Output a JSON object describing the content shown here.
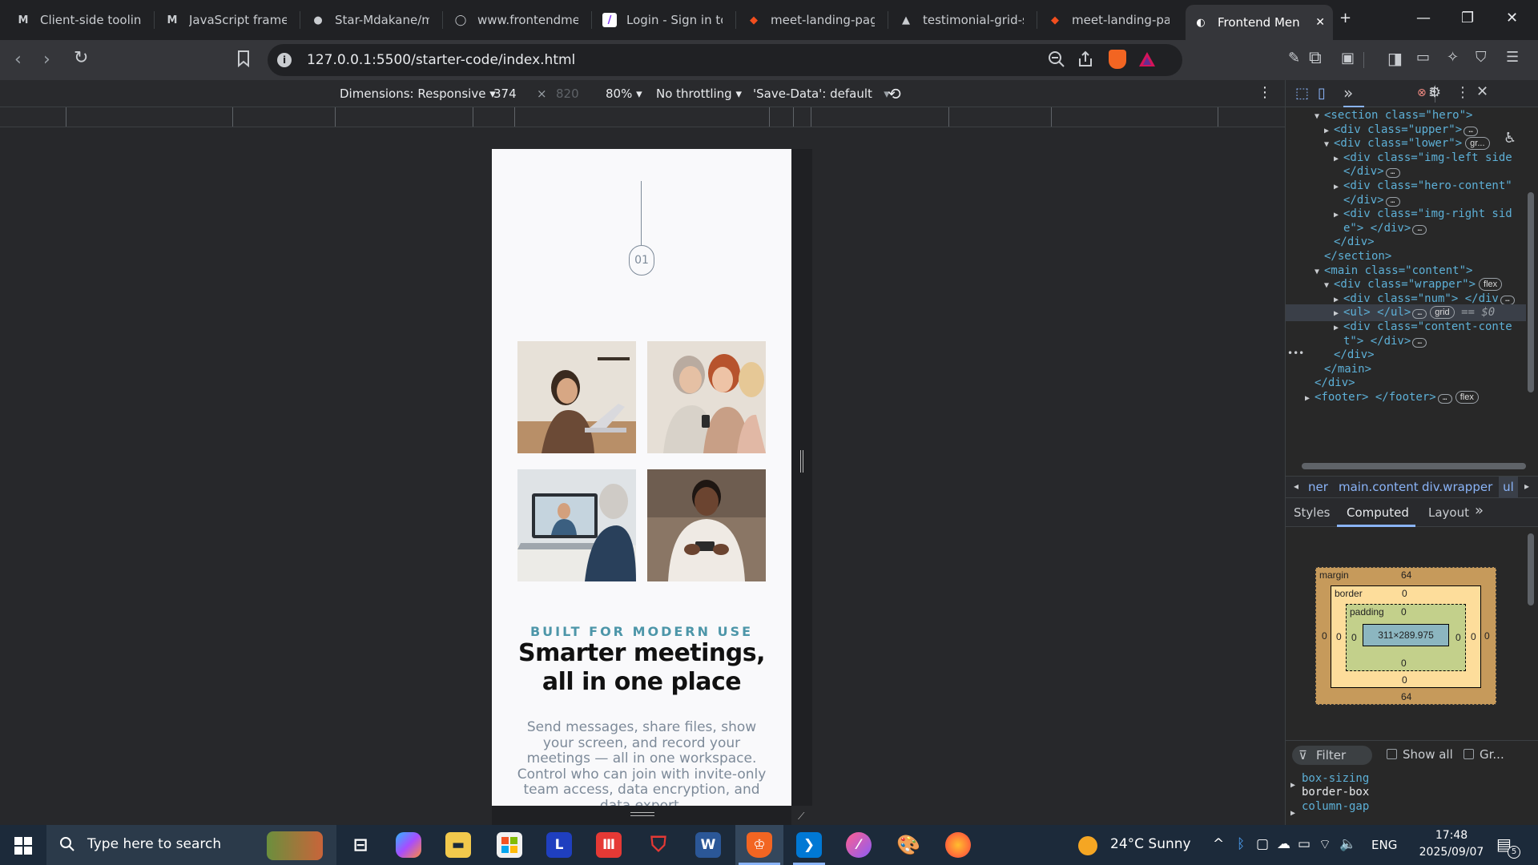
{
  "tabs": [
    {
      "title": "Client-side tooling",
      "icon": "M"
    },
    {
      "title": "JavaScript framew",
      "icon": "M"
    },
    {
      "title": "Star-Mdakane/me",
      "icon": "github"
    },
    {
      "title": "www.frontendmen",
      "icon": "circle"
    },
    {
      "title": "Login - Sign in to",
      "icon": "slash"
    },
    {
      "title": "meet-landing-pag",
      "icon": "figma"
    },
    {
      "title": "testimonial-grid-s",
      "icon": "triangle"
    },
    {
      "title": "meet-landing-pag",
      "icon": "figma"
    },
    {
      "title": "Frontend Men",
      "icon": "fm",
      "active": true
    }
  ],
  "address": {
    "url": "127.0.0.1:5500/starter-code/index.html",
    "badge_count": "3"
  },
  "devtools": {
    "dimensions_label": "Dimensions: Responsive",
    "width": "374",
    "times": "×",
    "height": "820",
    "zoom": "80%",
    "throttle": "No throttling",
    "save_data": "'Save-Data': default",
    "error_count": "3",
    "breadcrumbs": [
      "ner",
      "main.content",
      "div.wrapper",
      "ul"
    ],
    "pane_tabs": [
      "Styles",
      "Computed",
      "Layout"
    ],
    "box_model": {
      "margin_label": "margin",
      "margin": "64",
      "border_label": "border",
      "border": "0",
      "padding_label": "padding",
      "padding": "0",
      "content": "311×289.975",
      "zero": "0"
    },
    "filter_placeholder": "Filter",
    "show_all": "Show all",
    "group": "Gr...",
    "props": [
      {
        "name": "box-sizing",
        "value": "border-box"
      },
      {
        "name": "column-gap",
        "value": ""
      }
    ]
  },
  "code_lines": [
    {
      "indent": 4,
      "arrow": "open",
      "text": "<section class=\"hero\">"
    },
    {
      "indent": 5,
      "arrow": "closed",
      "text": "<div class=\"upper\">",
      "ell": true
    },
    {
      "indent": 5,
      "arrow": "open",
      "text": "<div class=\"lower\">",
      "badge": "gr..."
    },
    {
      "indent": 6,
      "arrow": "closed",
      "text": "<div class=\"img-left side"
    },
    {
      "indent": 6,
      "arrow": "",
      "text": "</div>",
      "ell": true
    },
    {
      "indent": 6,
      "arrow": "closed",
      "text": "<div class=\"hero-content\""
    },
    {
      "indent": 6,
      "arrow": "",
      "text": "</div>",
      "ell": true
    },
    {
      "indent": 6,
      "arrow": "closed",
      "text": "<div class=\"img-right sid"
    },
    {
      "indent": 6,
      "arrow": "",
      "text": "e\"> </div>",
      "ell": true
    },
    {
      "indent": 5,
      "arrow": "",
      "text": "</div>"
    },
    {
      "indent": 4,
      "arrow": "",
      "text": "</section>"
    },
    {
      "indent": 4,
      "arrow": "open",
      "text": "<main class=\"content\">"
    },
    {
      "indent": 5,
      "arrow": "open",
      "text": "<div class=\"wrapper\">",
      "badge": "flex"
    },
    {
      "indent": 6,
      "arrow": "closed",
      "text": "<div class=\"num\"> </div",
      "ell": true
    },
    {
      "indent": 6,
      "arrow": "closed",
      "text": "<ul> </ul>",
      "ell": true,
      "badge": "grid",
      "selected": true,
      "suffix": " == $0"
    },
    {
      "indent": 6,
      "arrow": "closed",
      "text": "<div class=\"content-conte"
    },
    {
      "indent": 6,
      "arrow": "",
      "text": "t\"> </div>",
      "ell": true
    },
    {
      "indent": 5,
      "arrow": "",
      "text": "</div>"
    },
    {
      "indent": 4,
      "arrow": "",
      "text": "</main>"
    },
    {
      "indent": 3,
      "arrow": "",
      "text": "</div>"
    },
    {
      "indent": 3,
      "arrow": "closed",
      "text": "<footer> </footer>",
      "ell": true,
      "badge": "flex"
    }
  ],
  "page": {
    "hero_number": "01",
    "eyebrow": "BUILT FOR MODERN USE",
    "heading": "Smarter meetings, all in one place",
    "paragraph": "Send messages, share files, show your screen, and record your meetings — all in one workspace. Control who can join with invite-only team access, data encryption, and data export.",
    "photos": [
      "woman-laptop",
      "women-phone",
      "man-video-call",
      "man-phone"
    ]
  },
  "taskbar": {
    "search_placeholder": "Type here to search",
    "weather": "24°C  Sunny",
    "lang": "ENG",
    "time": "17:48",
    "date": "2025/09/07",
    "notifications": "5"
  },
  "colors": {
    "accent": "#4d96a9",
    "heading": "#111111",
    "body": "#7d8a99"
  }
}
